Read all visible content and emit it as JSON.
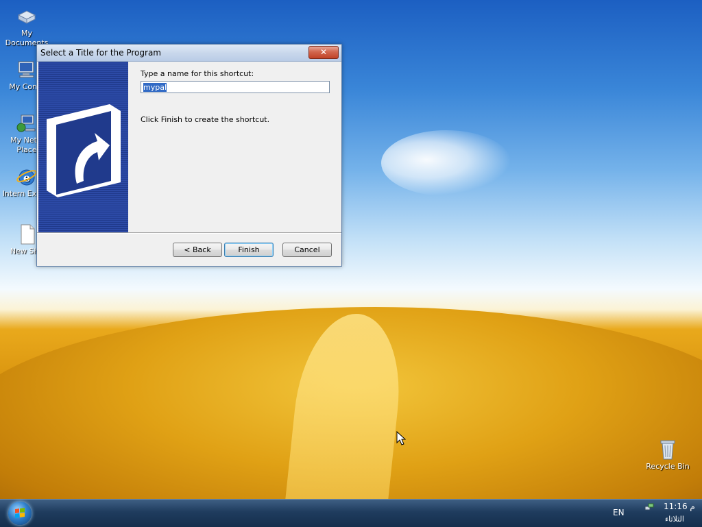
{
  "desktop": {
    "icons": [
      {
        "label": "My Documents",
        "icon": "my-documents-icon"
      },
      {
        "label": "My Comp",
        "icon": "my-computer-icon"
      },
      {
        "label": "My Netw Place",
        "icon": "network-places-icon"
      },
      {
        "label": "Intern Explor",
        "icon": "internet-explorer-icon"
      },
      {
        "label": "New Sho",
        "icon": "new-shortcut-icon"
      },
      {
        "label": "Recycle Bin",
        "icon": "recycle-bin-icon"
      }
    ]
  },
  "dialog": {
    "title": "Select a Title for the Program",
    "close_label": "✕",
    "name_label": "Type a name for this shortcut:",
    "name_value": "mypal",
    "hint": "Click Finish to create the shortcut.",
    "buttons": {
      "back": "< Back",
      "finish": "Finish",
      "cancel": "Cancel"
    }
  },
  "taskbar": {
    "language": "EN",
    "clock_time": "11:16 م",
    "clock_day": "الثلاثاء"
  },
  "colors": {
    "sidebar_blue": "#203a8c",
    "taskbar": "#1f3c5e"
  }
}
